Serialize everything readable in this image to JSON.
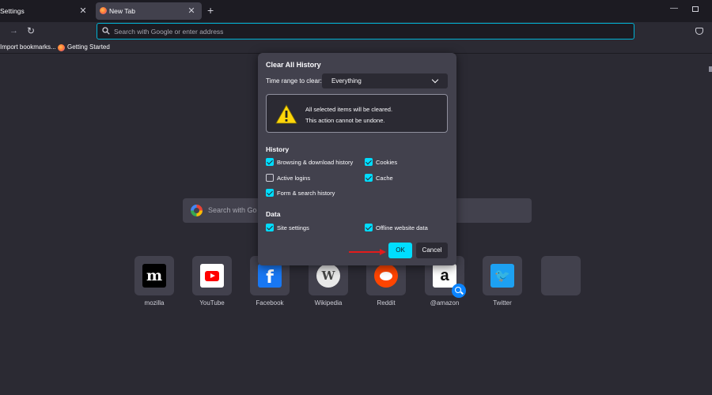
{
  "tabs": [
    {
      "label": "Settings",
      "active": false
    },
    {
      "label": "New Tab",
      "active": true
    }
  ],
  "urlbar": {
    "placeholder": "Search with Google or enter address"
  },
  "bookmarks": [
    "Import bookmarks...",
    "Getting Started"
  ],
  "content_search": {
    "placeholder": "Search with Goo"
  },
  "top_sites": [
    {
      "label": "mozilla",
      "logo_text": "m"
    },
    {
      "label": "YouTube",
      "logo_text": ""
    },
    {
      "label": "Facebook",
      "logo_text": "f"
    },
    {
      "label": "Wikipedia",
      "logo_text": "W"
    },
    {
      "label": "Reddit",
      "logo_text": ""
    },
    {
      "label": "@amazon",
      "logo_text": "a"
    },
    {
      "label": "Twitter",
      "logo_text": "🐦"
    },
    {
      "label": "",
      "logo_text": ""
    }
  ],
  "dialog": {
    "title": "Clear All History",
    "range_label": "Time range to clear:",
    "range_value": "Everything",
    "warning_line1": "All selected items will be cleared.",
    "warning_line2": "This action cannot be undone.",
    "history_heading": "History",
    "history_items": [
      {
        "label": "Browsing & download history",
        "checked": true
      },
      {
        "label": "Cookies",
        "checked": true
      },
      {
        "label": "Active logins",
        "checked": false
      },
      {
        "label": "Cache",
        "checked": true
      },
      {
        "label": "Form & search history",
        "checked": true
      }
    ],
    "data_heading": "Data",
    "data_items": [
      {
        "label": "Site settings",
        "checked": true
      },
      {
        "label": "Offline website data",
        "checked": true
      }
    ],
    "ok_label": "OK",
    "cancel_label": "Cancel"
  },
  "colors": {
    "accent": "#00ddff",
    "annotation_arrow": "#e31b1b",
    "background": "#2b2a33",
    "panel": "#42414d"
  }
}
